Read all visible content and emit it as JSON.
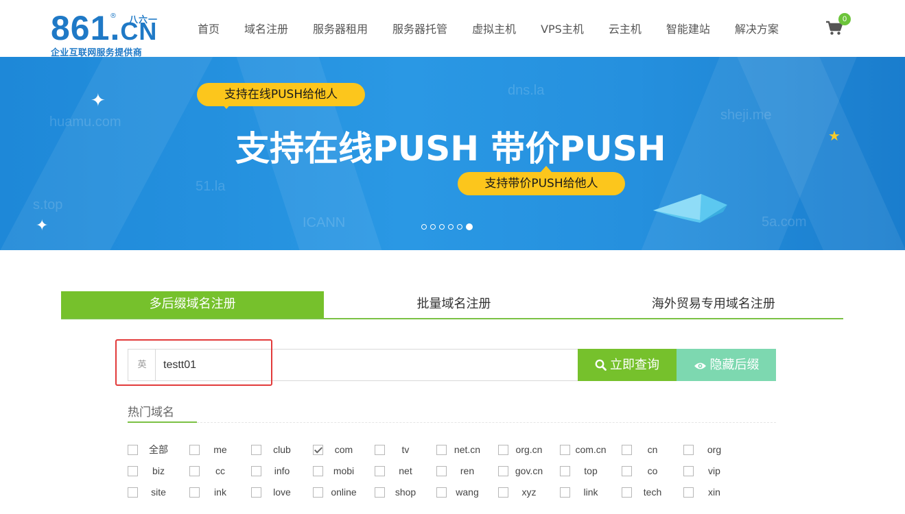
{
  "header": {
    "logo": {
      "main": "861",
      "dot": ".",
      "cn": "CN",
      "registered": "®",
      "chinese": "八六一",
      "tagline": "企业互联网服务提供商"
    },
    "nav": [
      "首页",
      "域名注册",
      "服务器租用",
      "服务器托管",
      "虚拟主机",
      "VPS主机",
      "云主机",
      "智能建站",
      "解决方案"
    ],
    "cart_count": "0"
  },
  "banner": {
    "pill_top": "支持在线PUSH给他人",
    "headline": "支持在线PUSH 带价PUSH",
    "pill_bottom": "支持带价PUSH给他人",
    "watermarks": [
      "huamu.com",
      "dns.la",
      "sheji.me",
      "51.la",
      "s.top",
      "ICANN",
      "5a.com"
    ],
    "slides_total": 6,
    "active_slide": 6
  },
  "tabs": [
    "多后缀域名注册",
    "批量域名注册",
    "海外贸易专用域名注册"
  ],
  "search": {
    "lang_label": "英",
    "value": "testt01",
    "search_button": "立即查询",
    "hide_button": "隐藏后缀"
  },
  "hot": {
    "title": "热门域名",
    "rows": [
      [
        {
          "label": "全部",
          "checked": false
        },
        {
          "label": "me",
          "checked": false
        },
        {
          "label": "club",
          "checked": false
        },
        {
          "label": "com",
          "checked": true
        },
        {
          "label": "tv",
          "checked": false
        },
        {
          "label": "net.cn",
          "checked": false
        },
        {
          "label": "org.cn",
          "checked": false
        },
        {
          "label": "com.cn",
          "checked": false
        },
        {
          "label": "cn",
          "checked": false
        },
        {
          "label": "org",
          "checked": false
        }
      ],
      [
        {
          "label": "biz",
          "checked": false
        },
        {
          "label": "cc",
          "checked": false
        },
        {
          "label": "info",
          "checked": false
        },
        {
          "label": "mobi",
          "checked": false
        },
        {
          "label": "net",
          "checked": false
        },
        {
          "label": "ren",
          "checked": false
        },
        {
          "label": "gov.cn",
          "checked": false
        },
        {
          "label": "top",
          "checked": false
        },
        {
          "label": "co",
          "checked": false
        },
        {
          "label": "vip",
          "checked": false
        }
      ],
      [
        {
          "label": "site",
          "checked": false
        },
        {
          "label": "ink",
          "checked": false
        },
        {
          "label": "love",
          "checked": false
        },
        {
          "label": "online",
          "checked": false
        },
        {
          "label": "shop",
          "checked": false
        },
        {
          "label": "wang",
          "checked": false
        },
        {
          "label": "xyz",
          "checked": false
        },
        {
          "label": "link",
          "checked": false
        },
        {
          "label": "tech",
          "checked": false
        },
        {
          "label": "xin",
          "checked": false
        }
      ]
    ]
  },
  "colors": {
    "brand_blue": "#1f79c6",
    "green": "#76c12c",
    "mint": "#7dd8b0",
    "banner_blue": "#2a98e4",
    "pill_yellow": "#fcc61c",
    "highlight_red": "#e23a3a"
  }
}
